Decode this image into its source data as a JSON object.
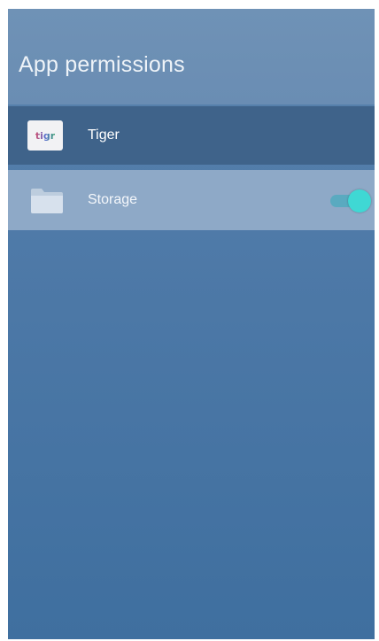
{
  "header": {
    "title": "App permissions"
  },
  "app_row": {
    "name": "Tiger",
    "icon": "tiger-app-icon",
    "icon_text": "tigr"
  },
  "permission_row": {
    "label": "Storage",
    "icon": "folder-icon",
    "toggle_on": true
  },
  "colors": {
    "background": "#4f7aa8",
    "header": "#6a8db3",
    "app_row": "#3f638a",
    "selected_row": "#8ea9c7",
    "toggle_accent": "#3fd8d4"
  }
}
